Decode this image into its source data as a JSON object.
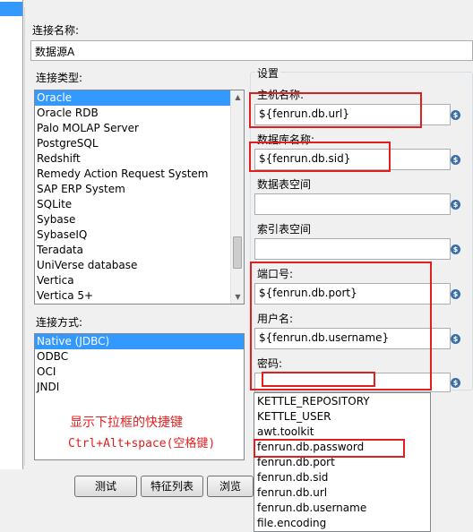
{
  "connection_name": {
    "label": "连接名称:",
    "value": "数据源A"
  },
  "connection_type": {
    "label": "连接类型:",
    "items": [
      "Oracle",
      "Oracle RDB",
      "Palo MOLAP Server",
      "PostgreSQL",
      "Redshift",
      "Remedy Action Request System",
      "SAP ERP System",
      "SQLite",
      "Sybase",
      "SybaseIQ",
      "Teradata",
      "UniVerse database",
      "Vertica",
      "Vertica 5+"
    ],
    "selected": "Oracle"
  },
  "access_method": {
    "label": "连接方式:",
    "items": [
      "Native (JDBC)",
      "ODBC",
      "OCI",
      "JNDI"
    ],
    "selected": "Native (JDBC)"
  },
  "settings": {
    "title": "设置",
    "host": {
      "label": "主机名称:",
      "value": "${fenrun.db.url}"
    },
    "database": {
      "label": "数据库名称:",
      "value": "${fenrun.db.sid}"
    },
    "tablespace_data": {
      "label": "数据表空间",
      "value": ""
    },
    "tablespace_index": {
      "label": "索引表空间",
      "value": ""
    },
    "port": {
      "label": "端口号:",
      "value": "${fenrun.db.port}"
    },
    "username": {
      "label": "用户名:",
      "value": "${fenrun.db.username}"
    },
    "password": {
      "label": "密码:",
      "value": ""
    }
  },
  "variable_icon": "dollar-variable-icon",
  "hint": {
    "line1": "显示下拉框的快捷键",
    "line2": "Ctrl+Alt+space(空格键)"
  },
  "buttons": {
    "test": "测试",
    "feature_list": "特征列表",
    "browse": "浏览"
  },
  "variable_dropdown": {
    "items": [
      "KETTLE_REPOSITORY",
      "KETTLE_USER",
      "awt.toolkit",
      "fenrun.db.password",
      "fenrun.db.port",
      "fenrun.db.sid",
      "fenrun.db.url",
      "fenrun.db.username",
      "file.encoding"
    ],
    "highlighted": "fenrun.db.password"
  },
  "colors": {
    "highlight": "#e02020",
    "selection": "#3399ff"
  }
}
